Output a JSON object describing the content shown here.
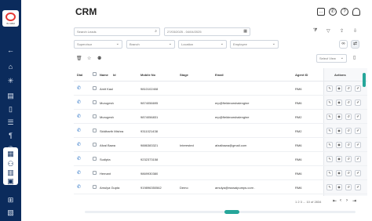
{
  "sidebar": {
    "logo_text": "W CRM",
    "icons": [
      {
        "name": "back-arrow-icon",
        "glyph": "←",
        "active": false
      },
      {
        "name": "home-icon",
        "glyph": "⌂",
        "active": false
      },
      {
        "name": "network-icon",
        "glyph": "✳",
        "active": false
      },
      {
        "name": "layers-icon",
        "glyph": "▤",
        "active": false
      },
      {
        "name": "document-icon",
        "glyph": "▯",
        "active": false
      },
      {
        "name": "list-icon",
        "glyph": "☰",
        "active": false
      },
      {
        "name": "stethoscope-icon",
        "glyph": "¶",
        "active": false
      },
      {
        "name": "phone-icon",
        "glyph": "✆",
        "active": false
      },
      {
        "name": "crm-apps-icon",
        "glyph": "▦",
        "active": true
      },
      {
        "name": "team-icon",
        "glyph": "⚇",
        "active": false
      },
      {
        "name": "library-icon",
        "glyph": "▥",
        "active": false
      },
      {
        "name": "contact-card-icon",
        "glyph": "▣",
        "active": false
      },
      {
        "name": "org-chart-icon",
        "glyph": "⊞",
        "active": false
      },
      {
        "name": "reports-icon",
        "glyph": "▧",
        "active": false
      }
    ]
  },
  "header": {
    "title": "CRM",
    "icons": [
      "chat-icon",
      "phone-icon",
      "help-icon",
      "notification-bell-icon"
    ]
  },
  "filters": {
    "search_placeholder": "Search Leads",
    "date_range": "27/03/2025 - 04/04/2025",
    "supervisor_placeholder": "Supervisor",
    "branch_placeholder": "Branch",
    "location_placeholder": "Location",
    "employee_placeholder": "Employee",
    "select_view_placeholder": "Select View"
  },
  "table": {
    "headers": {
      "dial": "Dial",
      "name": "Name",
      "id": "Id",
      "mobile": "Mobile No",
      "stage": "Stage",
      "email": "Email",
      "agent": "Agent ID",
      "actions": "Actions"
    },
    "rows": [
      {
        "name": "Amit Kaul",
        "mobile": "9810102408",
        "stage": "",
        "email": "",
        "agent": "RM6"
      },
      {
        "name": "Murugesh",
        "mobile": "9874056695",
        "stage": "",
        "email": "erp@fieldmarshalengine",
        "agent": "RM6"
      },
      {
        "name": "Murugesh",
        "mobile": "9874056831",
        "stage": "",
        "email": "erp@fieldmarshalengine",
        "agent": "RM2"
      },
      {
        "name": "Siddharth Mishra",
        "mobile": "9311021438",
        "stage": "",
        "email": "",
        "agent": "RM2"
      },
      {
        "name": "Afzal Bawa",
        "mobile": "9886383321",
        "stage": "Interested",
        "email": "afzalbawa@gmail.com",
        "agent": "RM6"
      },
      {
        "name": "Sudipta",
        "mobile": "9232373158",
        "stage": "",
        "email": "",
        "agent": "RM6"
      },
      {
        "name": "Hemant",
        "mobile": "9869930380",
        "stage": "",
        "email": "",
        "agent": "RM6"
      },
      {
        "name": "Amulya Gupta",
        "mobile": "919896350562",
        "stage": "Demo",
        "email": "amulya@rsswaipumps.com .",
        "agent": "RM6"
      }
    ]
  },
  "pagination": {
    "range_text": "1  2  3  ...  10 of 2834"
  },
  "colors": {
    "sidebar": "#0b2b5c",
    "accent": "#26a69a",
    "dial": "#1565c0"
  }
}
